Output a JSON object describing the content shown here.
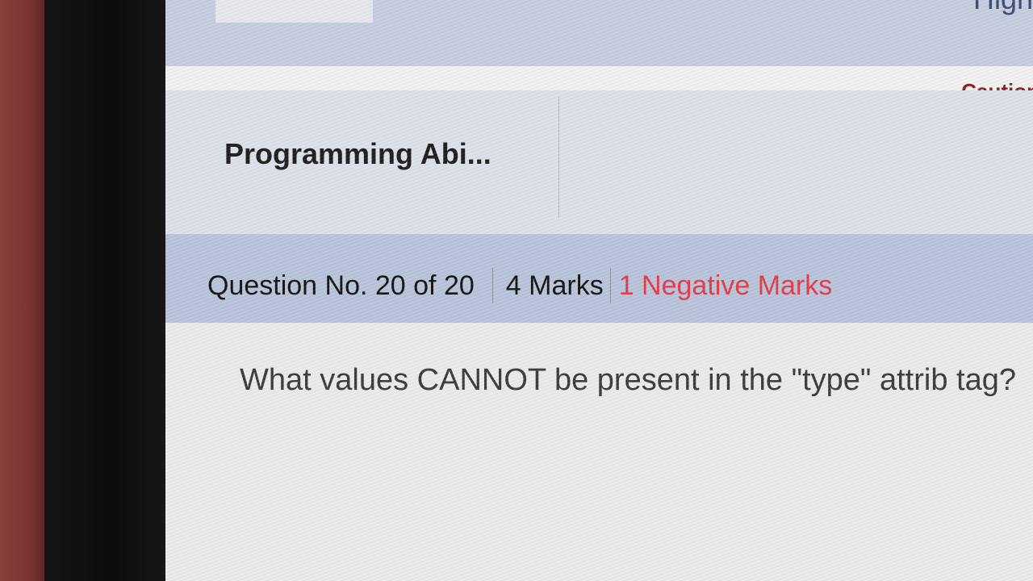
{
  "header": {
    "top_right_partial": "High",
    "caution_label": "Caution"
  },
  "section": {
    "name": "Programming Abi..."
  },
  "question": {
    "number_label": "Question No. 20 of 20",
    "marks_label": "4 Marks",
    "negative_label": "1 Negative Marks",
    "text": "What values CANNOT be present in the \"type\" attrib tag?"
  },
  "colors": {
    "negative_marks": "#e23b46",
    "caution": "#8b1e1e",
    "question_bar": "#b9c4dc",
    "header_bar": "#c6cde0"
  }
}
